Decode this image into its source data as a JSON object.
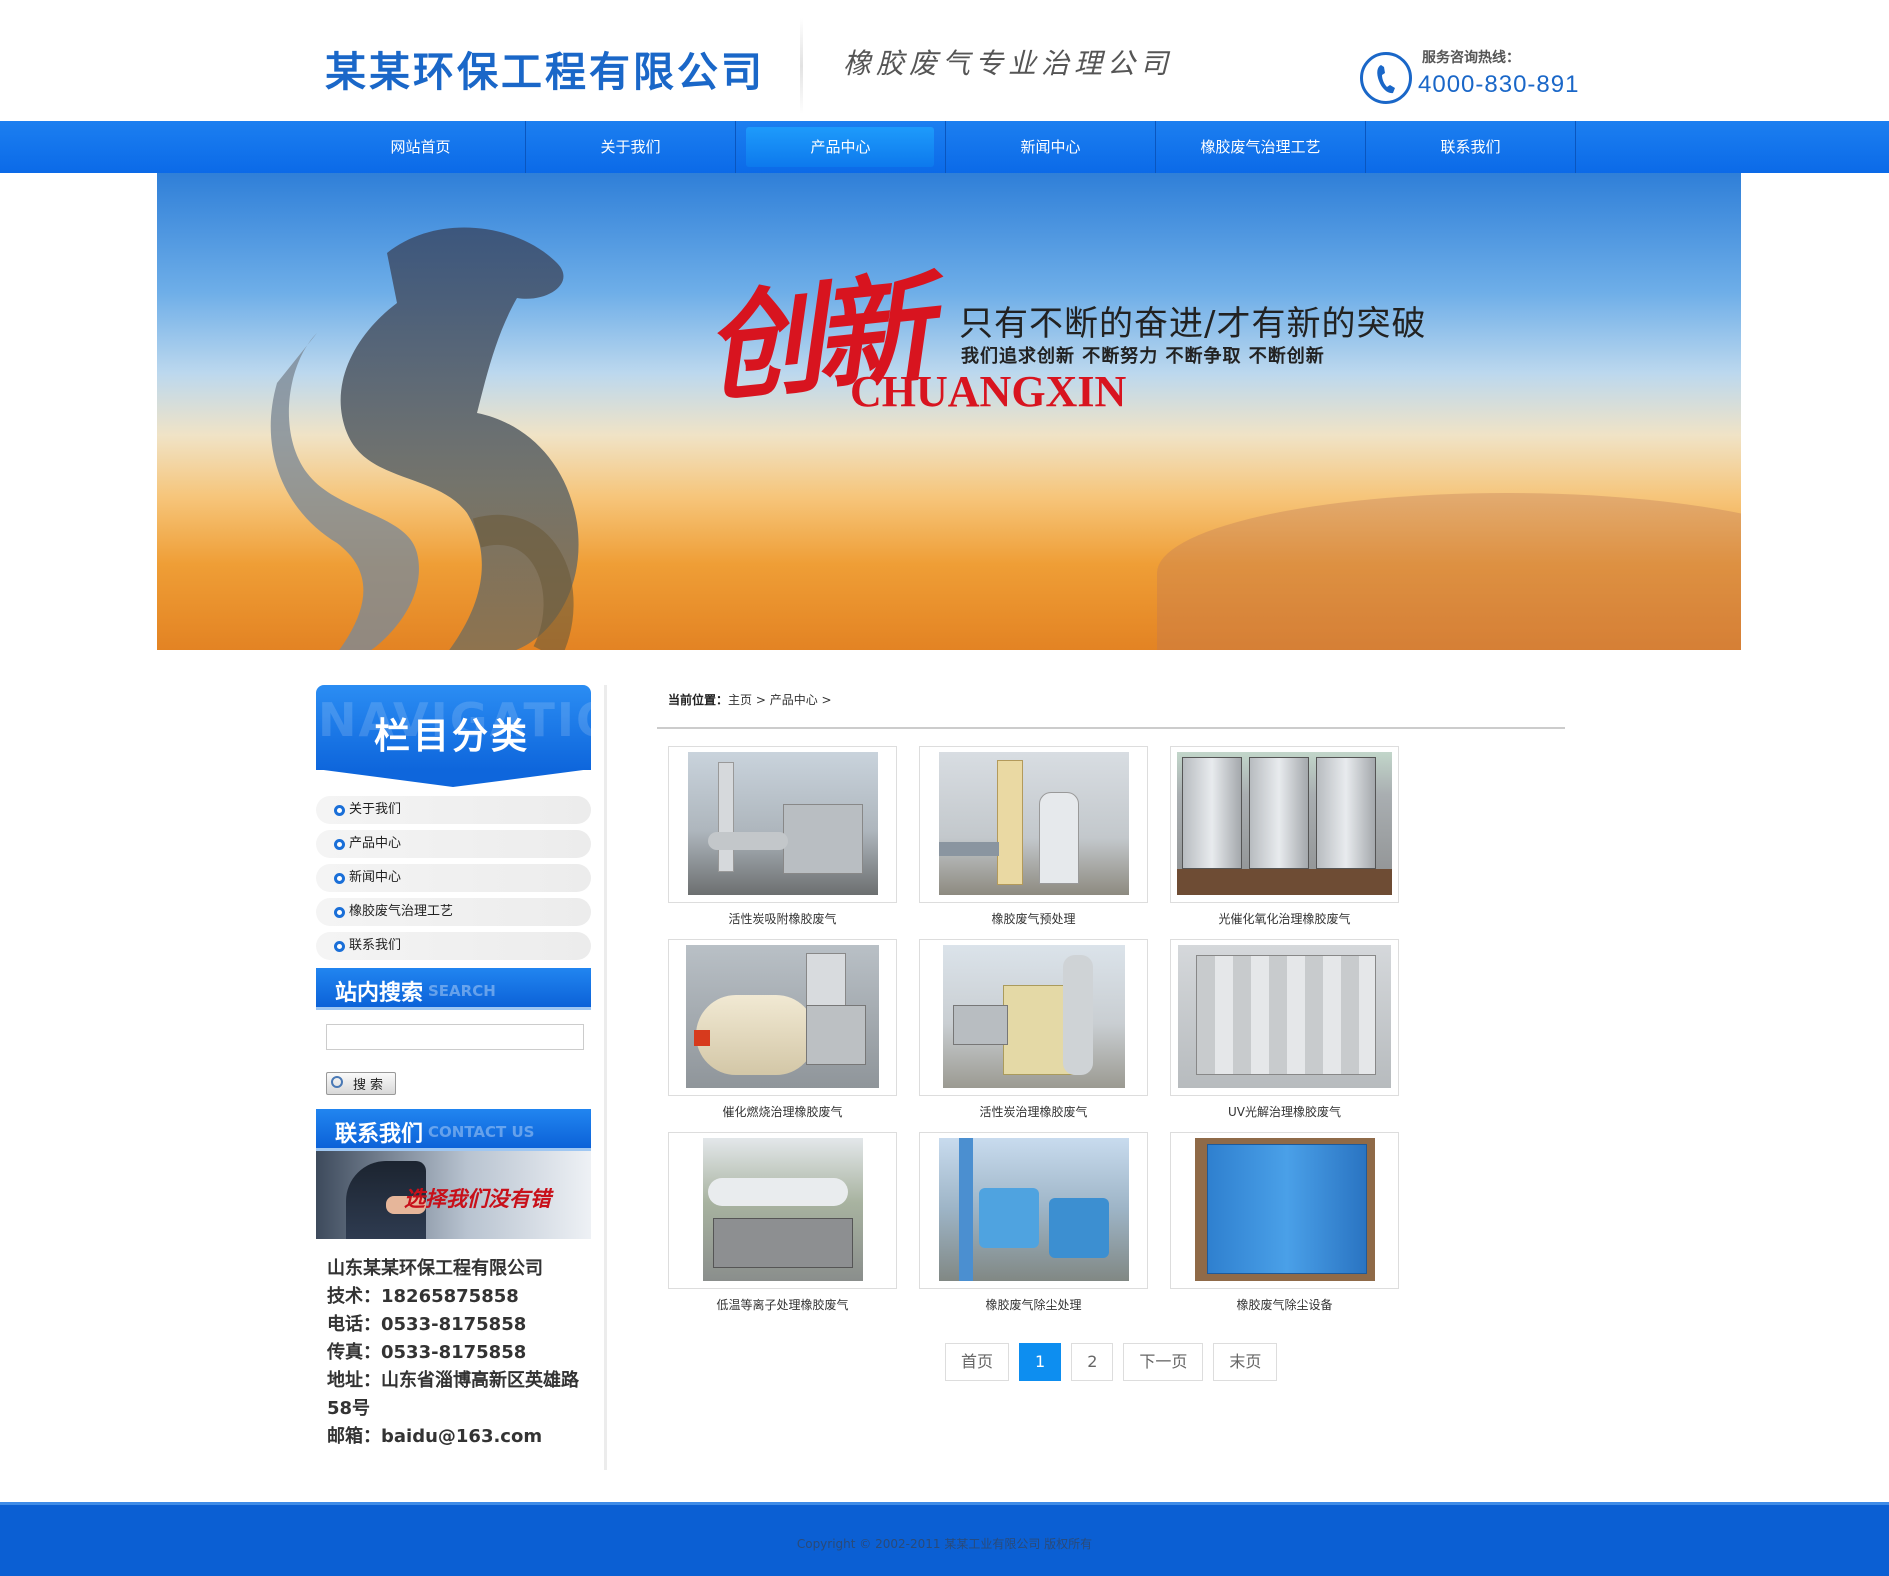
{
  "header": {
    "company_name": "某某环保工程有限公司",
    "slogan": "橡胶废气专业治理公司",
    "hotline_label": "服务咨询热线：",
    "hotline_number": "4000-830-891"
  },
  "nav": {
    "items": [
      {
        "label": "网站首页"
      },
      {
        "label": "关于我们"
      },
      {
        "label": "产品中心",
        "active": true
      },
      {
        "label": "新闻中心"
      },
      {
        "label": "橡胶废气治理工艺"
      },
      {
        "label": "联系我们"
      }
    ]
  },
  "banner": {
    "big_text": "创新",
    "headline": "只有不断的奋进/才有新的突破",
    "subline": "我们追求创新  不断努力  不断争取  不断创新",
    "english": "CHUANGXIN"
  },
  "sidebar": {
    "category_title": "栏目分类",
    "category_watermark": "NAVIGATION",
    "categories": [
      {
        "label": "关于我们"
      },
      {
        "label": "产品中心"
      },
      {
        "label": "新闻中心"
      },
      {
        "label": "橡胶废气治理工艺"
      },
      {
        "label": "联系我们"
      }
    ],
    "search_title": "站内搜索",
    "search_title_en": "SEARCH",
    "search_placeholder": "",
    "search_button": "搜索",
    "contact_title": "联系我们",
    "contact_title_en": "CONTACT US",
    "contact_image_text": "选择我们没有错",
    "contact": {
      "company": "山东某某环保工程有限公司",
      "tech": "技术：18265875858",
      "phone": "电话：0533-8175858",
      "fax": "传真：0533-8175858",
      "address_1": "地址：山东省淄博高新区英雄路",
      "address_2": "58号",
      "email": "邮箱：baidu@163.com"
    }
  },
  "breadcrumb": {
    "label": "当前位置：",
    "path": "主页 > 产品中心 >"
  },
  "products": [
    {
      "caption": "活性炭吸附橡胶废气"
    },
    {
      "caption": "橡胶废气预处理"
    },
    {
      "caption": "光催化氧化治理橡胶废气"
    },
    {
      "caption": "催化燃烧治理橡胶废气"
    },
    {
      "caption": "活性炭治理橡胶废气"
    },
    {
      "caption": "UV光解治理橡胶废气"
    },
    {
      "caption": "低温等离子处理橡胶废气"
    },
    {
      "caption": "橡胶废气除尘处理"
    },
    {
      "caption": "橡胶废气除尘设备"
    }
  ],
  "pagination": {
    "first": "首页",
    "pages": [
      "1",
      "2"
    ],
    "current": "1",
    "next": "下一页",
    "last": "末页"
  },
  "footer": {
    "copyright": "Copyright © 2002-2011 某某工业有限公司 版权所有"
  },
  "colors": {
    "primary_blue": "#0b6ae8",
    "brand_red": "#d8141f",
    "footer_blue": "#0b5fd3"
  }
}
